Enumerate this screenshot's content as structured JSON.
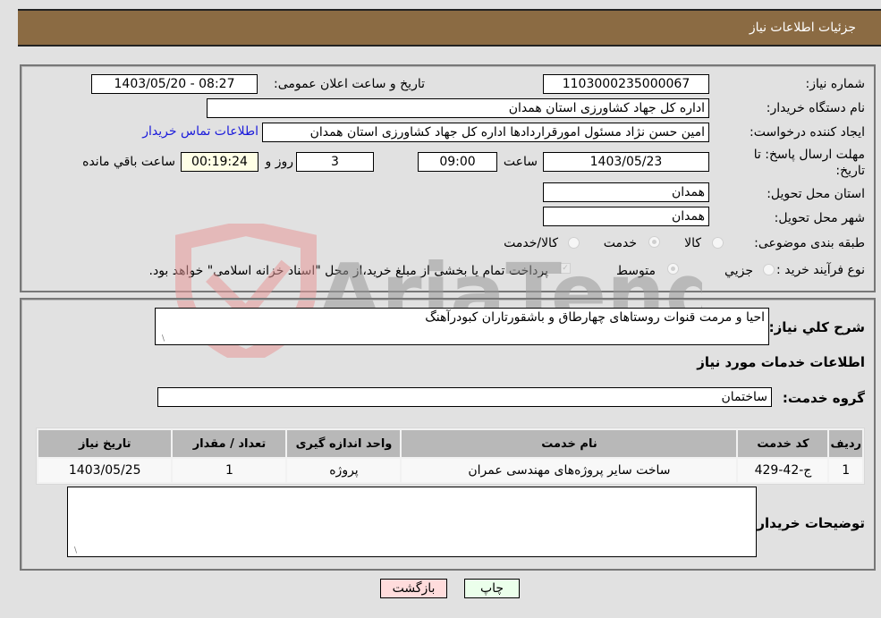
{
  "header": {
    "title": "جزئیات اطلاعات نیاز"
  },
  "form": {
    "need_number": {
      "label": "شماره نیاز:",
      "value": "1103000235000067"
    },
    "announce_datetime": {
      "label": "تاریخ و ساعت اعلان عمومی:",
      "value": "1403/05/20 - 08:27"
    },
    "buyer_org": {
      "label": "نام دستگاه خریدار:",
      "value": "اداره کل جهاد کشاورزی استان همدان"
    },
    "requester": {
      "label": "ایجاد کننده درخواست:",
      "value": "امین حسن نژاد مسئول امورقراردادها اداره کل جهاد کشاورزی استان همدان"
    },
    "buyer_contact_link": "اطلاعات تماس خریدار",
    "deadline": {
      "label_line1": "مهلت ارسال پاسخ: تا",
      "label_line2": "تاریخ:",
      "date": "1403/05/23",
      "time_label": "ساعت",
      "time": "09:00",
      "days": "3",
      "days_label": "روز و",
      "remaining": "00:19:24",
      "remaining_label": "ساعت باقي مانده"
    },
    "province": {
      "label": "استان محل تحویل:",
      "value": "همدان"
    },
    "city": {
      "label": "شهر محل تحویل:",
      "value": "همدان"
    },
    "category": {
      "label": "طبقه بندی موضوعی:",
      "options": [
        "کالا",
        "خدمت",
        "کالا/خدمت"
      ],
      "selected": "خدمت"
    },
    "purchase_type": {
      "label": "نوع فرآیند خرید :",
      "options": [
        "جزيي",
        "متوسط"
      ],
      "selected": "متوسط",
      "payment_checkbox_label": "پرداخت تمام یا بخشی از مبلغ خرید،از محل \"اسناد خزانه اسلامی\" خواهد بود.",
      "payment_checked": true
    }
  },
  "details": {
    "description_label": "شرح کلي نياز:",
    "description_value": "احیا و مرمت قنوات روستاهای چهارطاق و باشقورتاران کبودرآهنگ",
    "services_title": "اطلاعات خدمات مورد نیاز",
    "service_group_label": "گروه خدمت:",
    "service_group_value": "ساختمان",
    "table": {
      "headers": [
        "ردیف",
        "کد خدمت",
        "نام خدمت",
        "واحد اندازه گیری",
        "تعداد / مقدار",
        "تاریخ نیاز"
      ],
      "rows": [
        [
          "1",
          "ج-42-429",
          "ساخت سایر پروژه‌های مهندسی عمران",
          "پروژه",
          "1",
          "1403/05/25"
        ]
      ]
    },
    "buyer_notes_label": "توضیحات خریدار:",
    "buyer_notes_value": ""
  },
  "buttons": {
    "print": "چاپ",
    "back": "بازگشت"
  },
  "watermark": {
    "text": "AriaTender.neT"
  }
}
